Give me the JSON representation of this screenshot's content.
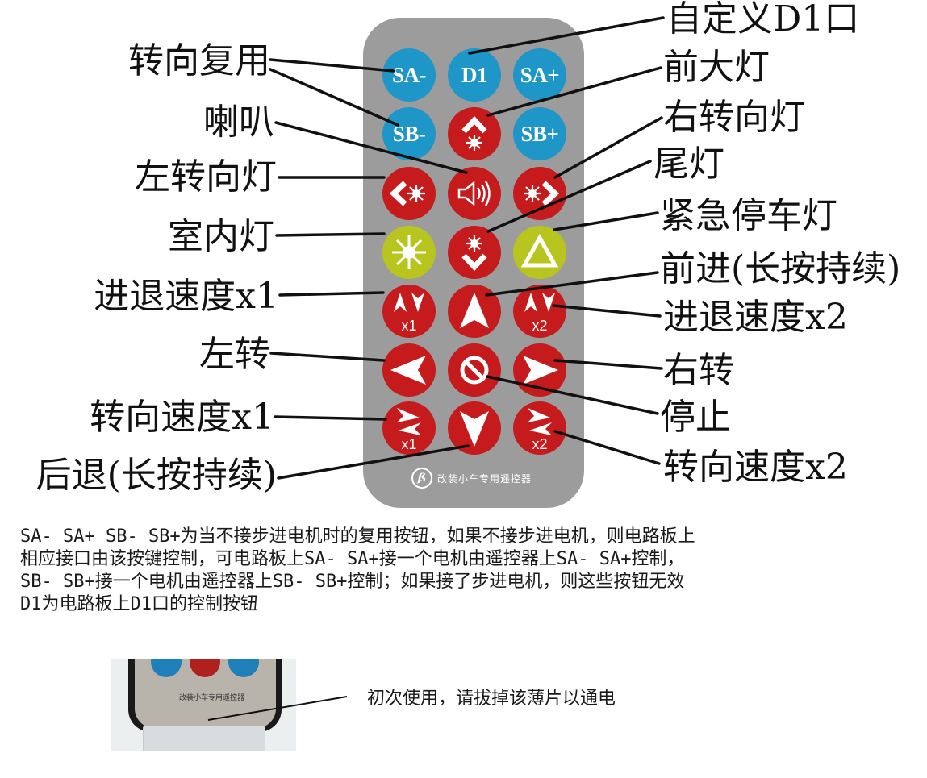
{
  "remote": {
    "colors": {
      "body": "#9c9c9c",
      "blue": "#1f96c8",
      "red": "#c51b1d",
      "yellow": "#b8c51e"
    },
    "buttons": {
      "sa_minus": "SA-",
      "d1": "D1",
      "sa_plus": "SA+",
      "sb_minus": "SB-",
      "sb_plus": "SB+",
      "speed_x1": "x1",
      "speed_x2": "x2",
      "turn_x1": "x1",
      "turn_x2": "x2"
    },
    "brand_text": "改装小车专用遥控器",
    "icons": [
      "headlight-icon",
      "horn-icon",
      "left-turn-signal-icon",
      "right-turn-signal-icon",
      "interior-light-icon",
      "tail-light-icon",
      "hazard-triangle-icon",
      "forward-arrow-icon",
      "backward-arrow-icon",
      "left-arrow-icon",
      "right-arrow-icon",
      "stop-icon"
    ]
  },
  "labels": {
    "left": {
      "steering_reuse": "转向复用",
      "horn": "喇叭",
      "left_turn_light": "左转向灯",
      "interior_light": "室内灯",
      "speed_x1": "进退速度x1",
      "turn_left": "左转",
      "turn_speed_x1": "转向速度x1",
      "backward": "后退(长按持续)"
    },
    "right": {
      "custom_d1": "自定义D1口",
      "headlight": "前大灯",
      "right_turn_light": "右转向灯",
      "tail_light": "尾灯",
      "hazard_light": "紧急停车灯",
      "forward": "前进(长按持续)",
      "speed_x2": "进退速度x2",
      "turn_right": "右转",
      "stop": "停止",
      "turn_speed_x2": "转向速度x2"
    }
  },
  "description": {
    "lines": [
      "SA- SA+ SB- SB+为当不接步进电机时的复用按钮，如果不接步进电机，则电路板上",
      "相应接口由该按键控制，可电路板上SA- SA+接一个电机由遥控器上SA- SA+控制，",
      "SB- SB+接一个电机由遥控器上SB- SB+控制；如果接了步进电机，则这些按钮无效",
      "D1为电路板上D1口的控制按钮"
    ]
  },
  "photo": {
    "brand_text": "改装小车专用遥控器",
    "note": "初次使用，请拔掉该薄片以通电"
  }
}
